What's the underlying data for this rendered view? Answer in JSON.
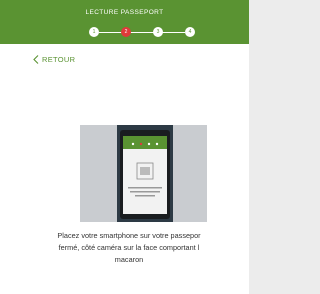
{
  "header": {
    "title": "LECTURE PASSEPORT",
    "steps": [
      {
        "label": "1",
        "active": false
      },
      {
        "label": "2",
        "active": true
      },
      {
        "label": "3",
        "active": false
      },
      {
        "label": "4",
        "active": false
      }
    ]
  },
  "back": {
    "icon": "chevron-left-icon",
    "label": "RETOUR"
  },
  "illustration": {
    "description_visible": false
  },
  "instruction": {
    "line1": "Placez votre smartphone sur votre passepor",
    "line2": "fermé, côté caméra sur la face comportant l",
    "line3": "macaron"
  },
  "colors": {
    "brand_green": "#5a9332",
    "active_step": "#e03a3a",
    "background": "#ececec",
    "card": "#ffffff"
  }
}
